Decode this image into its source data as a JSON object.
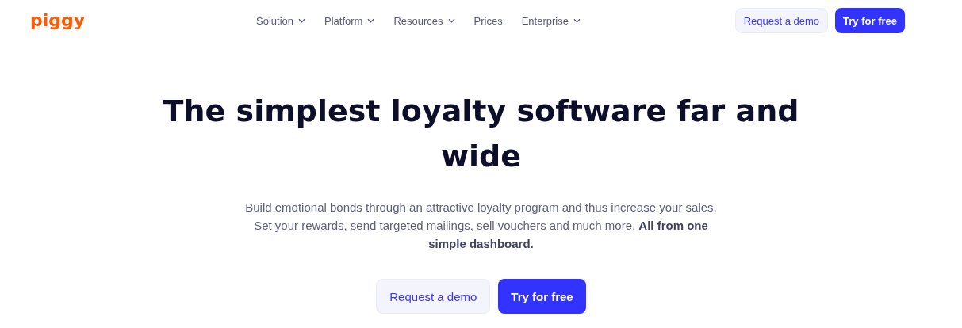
{
  "header": {
    "logo": "piggy",
    "nav": [
      {
        "label": "Solution",
        "has_dropdown": true
      },
      {
        "label": "Platform",
        "has_dropdown": true
      },
      {
        "label": "Resources",
        "has_dropdown": true
      },
      {
        "label": "Prices",
        "has_dropdown": false
      },
      {
        "label": "Enterprise",
        "has_dropdown": true
      }
    ],
    "buttons": [
      {
        "label": "Request a demo",
        "kind": "secondary"
      },
      {
        "label": "Try for free",
        "kind": "primary"
      }
    ]
  },
  "hero": {
    "title": "The simplest loyalty software far and wide",
    "text": "Build emotional bonds through an attractive loyalty program and thus increase your sales. Set your rewards, send targeted mailings, sell vouchers and much more. **All from one simple dashboard.**",
    "buttons": [
      {
        "label": "Request a demo",
        "kind": "secondary"
      },
      {
        "label": "Try for free",
        "kind": "primary"
      }
    ]
  }
}
